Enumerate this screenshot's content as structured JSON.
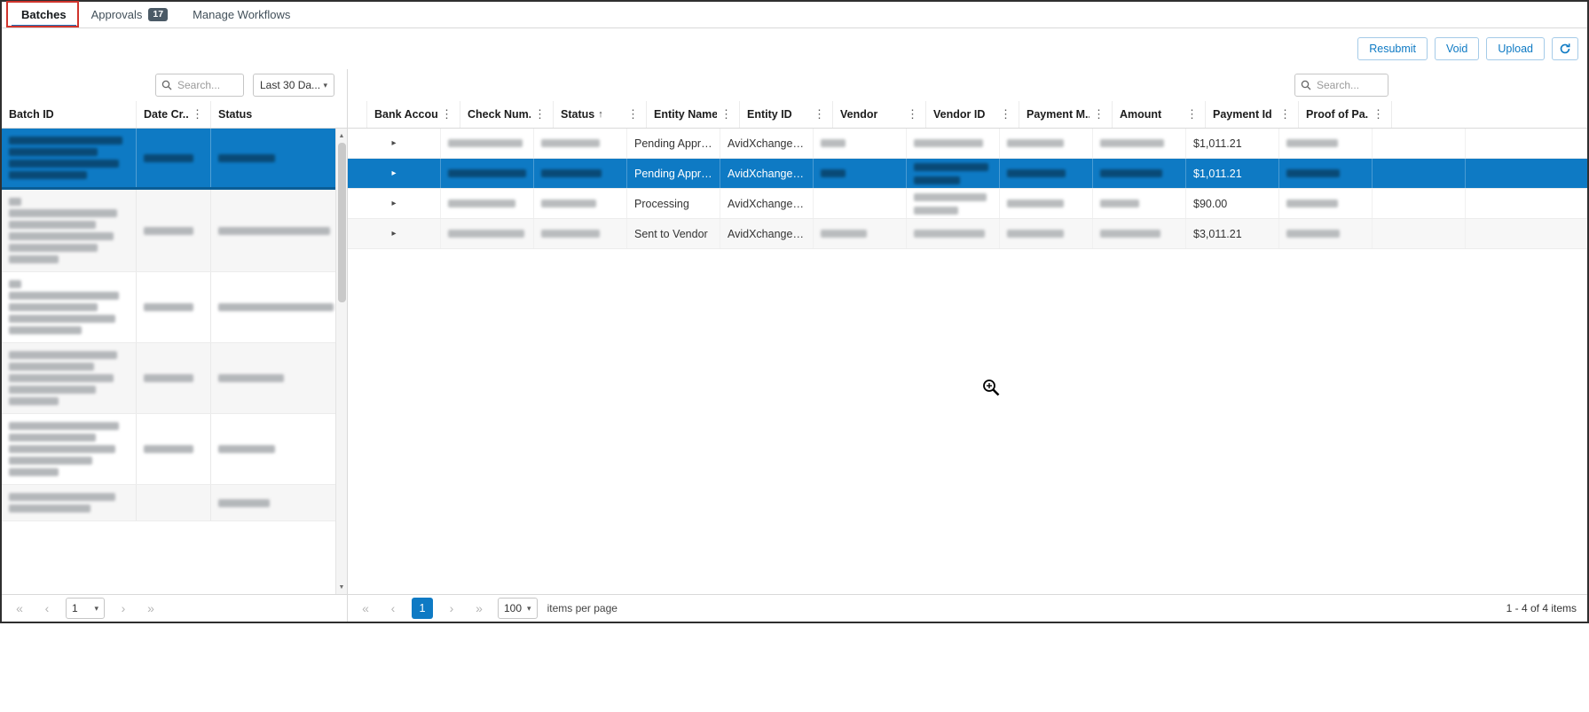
{
  "colors": {
    "accent": "#0e7ac4",
    "selection_bg": "#0e7ac4",
    "selection_border": "#0a5e97",
    "tab_underline": "#1d6fb8",
    "badge_bg": "#4b5a66",
    "annotation_red": "#d0342c",
    "button_border": "#a5cbe8"
  },
  "icons": {
    "search": "search-icon",
    "refresh": "refresh-icon",
    "column_menu": "kebab-menu-icon",
    "sort_ascending": "sort-ascending-icon",
    "expand_row": "chevron-right-icon",
    "dropdown": "chevron-down-icon",
    "scroll_up": "scroll-up-icon",
    "scroll_down": "scroll-down-icon",
    "zoom_cursor": "zoom-in-cursor-icon"
  },
  "tabbar": {
    "tabs": [
      {
        "label": "Batches",
        "active": true
      },
      {
        "label": "Approvals",
        "badge": "17",
        "active": false
      },
      {
        "label": "Manage Workflows",
        "active": false
      }
    ]
  },
  "toolbar": {
    "resubmit_label": "Resubmit",
    "void_label": "Void",
    "upload_label": "Upload"
  },
  "left_panel": {
    "search_placeholder": "Search...",
    "date_filter_value": "Last 30 Da...",
    "columns": [
      {
        "label": "Batch ID",
        "menu": false
      },
      {
        "label": "Date Cr...",
        "menu": true
      },
      {
        "label": "Status",
        "menu": false
      }
    ],
    "rows": [
      {
        "selected": true,
        "batch": [
          128,
          100,
          124,
          88
        ],
        "date": [
          56
        ],
        "status": [
          64
        ]
      },
      {
        "selected": false,
        "batch": [
          14,
          122,
          98,
          118,
          100,
          56
        ],
        "date": [
          56
        ],
        "status": [
          126
        ]
      },
      {
        "selected": false,
        "batch": [
          14,
          124,
          100,
          120,
          82
        ],
        "date": [
          56
        ],
        "status": [
          130
        ]
      },
      {
        "selected": false,
        "batch": [
          122,
          96,
          118,
          98,
          56
        ],
        "date": [
          56
        ],
        "status": [
          74
        ]
      },
      {
        "selected": false,
        "batch": [
          124,
          98,
          120,
          94,
          56
        ],
        "date": [
          56
        ],
        "status": [
          64
        ]
      },
      {
        "selected": false,
        "batch": [
          120,
          92
        ],
        "date": [],
        "status": [
          58
        ]
      }
    ],
    "pager": {
      "page": "1"
    }
  },
  "right_panel": {
    "search_placeholder": "Search...",
    "columns": [
      {
        "label": "Bank Account",
        "menu": true
      },
      {
        "label": "Check Num...",
        "menu": true
      },
      {
        "label": "Status",
        "menu": true,
        "sort": "asc"
      },
      {
        "label": "Entity Name",
        "menu": true
      },
      {
        "label": "Entity ID",
        "menu": true
      },
      {
        "label": "Vendor",
        "menu": true
      },
      {
        "label": "Vendor ID",
        "menu": true
      },
      {
        "label": "Payment M...",
        "menu": true
      },
      {
        "label": "Amount",
        "menu": true
      },
      {
        "label": "Payment Id",
        "menu": true
      },
      {
        "label": "Proof of Pa...",
        "menu": true
      }
    ],
    "rows": [
      {
        "selected": false,
        "cells": [
          {
            "r": [
              84
            ]
          },
          {
            "r": [
              66
            ]
          },
          {
            "t": "Pending Approval"
          },
          {
            "t": "AvidXchange, Inc"
          },
          {
            "r": [
              28
            ]
          },
          {
            "r": [
              78
            ]
          },
          {
            "r": [
              64
            ]
          },
          {
            "r": [
              72
            ]
          },
          {
            "t": "$1,011.21"
          },
          {
            "r": [
              58
            ]
          },
          {
            "t": ""
          }
        ]
      },
      {
        "selected": true,
        "cells": [
          {
            "r": [
              88
            ]
          },
          {
            "r": [
              68
            ]
          },
          {
            "t": "Pending Approval"
          },
          {
            "t": "AvidXchange, Inc"
          },
          {
            "r": [
              28
            ]
          },
          {
            "r": [
              84,
              52
            ]
          },
          {
            "r": [
              66
            ]
          },
          {
            "r": [
              70
            ]
          },
          {
            "t": "$1,011.21"
          },
          {
            "r": [
              60
            ]
          },
          {
            "t": ""
          }
        ]
      },
      {
        "selected": false,
        "cells": [
          {
            "r": [
              76
            ]
          },
          {
            "r": [
              62
            ]
          },
          {
            "t": "Processing"
          },
          {
            "t": "AvidXchange, Inc"
          },
          {
            "t": ""
          },
          {
            "r": [
              82,
              50
            ]
          },
          {
            "r": [
              64
            ]
          },
          {
            "r": [
              44
            ]
          },
          {
            "t": "$90.00"
          },
          {
            "r": [
              58
            ]
          },
          {
            "t": ""
          }
        ]
      },
      {
        "selected": false,
        "cells": [
          {
            "r": [
              86
            ]
          },
          {
            "r": [
              66
            ]
          },
          {
            "t": "Sent to Vendor"
          },
          {
            "t": "AvidXchange, Inc"
          },
          {
            "r": [
              52
            ]
          },
          {
            "r": [
              80
            ]
          },
          {
            "r": [
              64
            ]
          },
          {
            "r": [
              68
            ]
          },
          {
            "t": "$3,011.21"
          },
          {
            "r": [
              60
            ]
          },
          {
            "t": ""
          }
        ]
      }
    ],
    "pager": {
      "page": "1",
      "page_size": "100",
      "items_label": "items per page",
      "range_label": "1 - 4 of 4 items"
    }
  }
}
